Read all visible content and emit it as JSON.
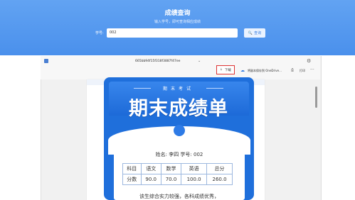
{
  "banner": {
    "title": "成绩查询",
    "subtitle": "输入学号，即可查询相应成绩",
    "search_label": "学号:",
    "search_value": "002",
    "search_button": "查询"
  },
  "viewer": {
    "doc_title": "665bb94f15f318f3887f47ee",
    "download_label": "下载",
    "onedrive_label": "将副本保存到 OneDrive...",
    "print_label": "打印",
    "more_label": "···"
  },
  "certificate": {
    "exam_label": "期末考试",
    "main_title": "期末成绩单",
    "student_line": "姓名: 李四    学号: 002",
    "table": {
      "headers": [
        "科目",
        "语文",
        "数学",
        "英语",
        "总分"
      ],
      "row_label": "分数",
      "values": [
        "90.0",
        "70.0",
        "100.0",
        "260.0"
      ]
    },
    "comment": "该生综合实力较强，各科成绩优秀，"
  },
  "colors": {
    "accent": "#4a90ec",
    "card": "#1f6fdb",
    "highlight": "#dd3333"
  }
}
